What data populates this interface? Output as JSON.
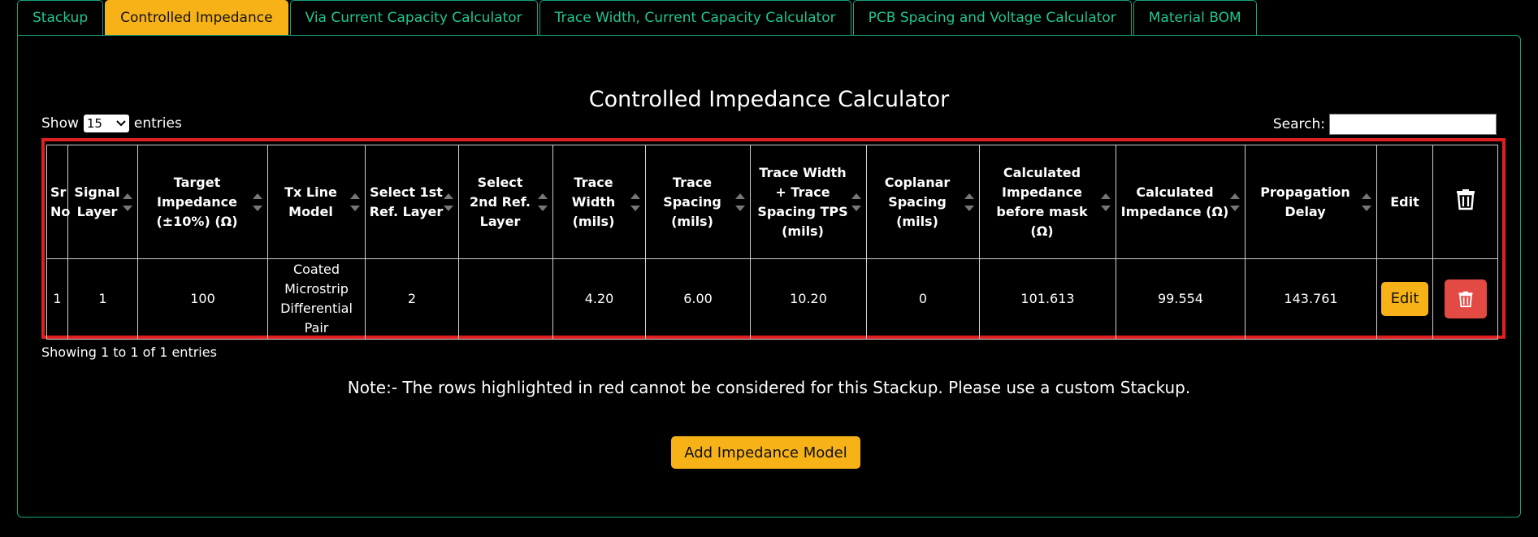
{
  "tabs": [
    {
      "label": "Stackup",
      "active": false
    },
    {
      "label": "Controlled Impedance",
      "active": true
    },
    {
      "label": "Via Current Capacity Calculator",
      "active": false
    },
    {
      "label": "Trace Width, Current Capacity Calculator",
      "active": false
    },
    {
      "label": "PCB Spacing and Voltage Calculator",
      "active": false
    },
    {
      "label": "Material BOM",
      "active": false
    }
  ],
  "title": "Controlled Impedance Calculator",
  "length_control": {
    "prefix": "Show",
    "value": "15",
    "suffix": "entries"
  },
  "search": {
    "label": "Search:",
    "value": ""
  },
  "table": {
    "headers": [
      "Sr No",
      "Signal Layer",
      "Target Impedance (±10%) (Ω)",
      "Tx Line Model",
      "Select 1st Ref. Layer",
      "Select 2nd Ref. Layer",
      "Trace Width (mils)",
      "Trace Spacing (mils)",
      "Trace Width + Trace Spacing TPS (mils)",
      "Coplanar Spacing (mils)",
      "Calculated Impedance before mask (Ω)",
      "Calculated Impedance (Ω)",
      "Propagation Delay",
      "Edit"
    ],
    "rows": [
      {
        "cells": [
          "1",
          "1",
          "100",
          "Coated Microstrip Differential Pair",
          "2",
          "",
          "4.20",
          "6.00",
          "10.20",
          "0",
          "101.613",
          "99.554",
          "143.761"
        ],
        "edit_label": "Edit"
      }
    ]
  },
  "info": "Showing 1 to 1 of 1 entries",
  "note": "Note:- The rows highlighted in red cannot be considered for this Stackup. Please use a custom Stackup.",
  "add_button": "Add Impedance Model",
  "colors": {
    "accent": "#f7b218",
    "tab_border": "#16a37d",
    "tab_text": "#1ec790",
    "danger": "#e34a43",
    "highlight_border": "#e02020"
  }
}
